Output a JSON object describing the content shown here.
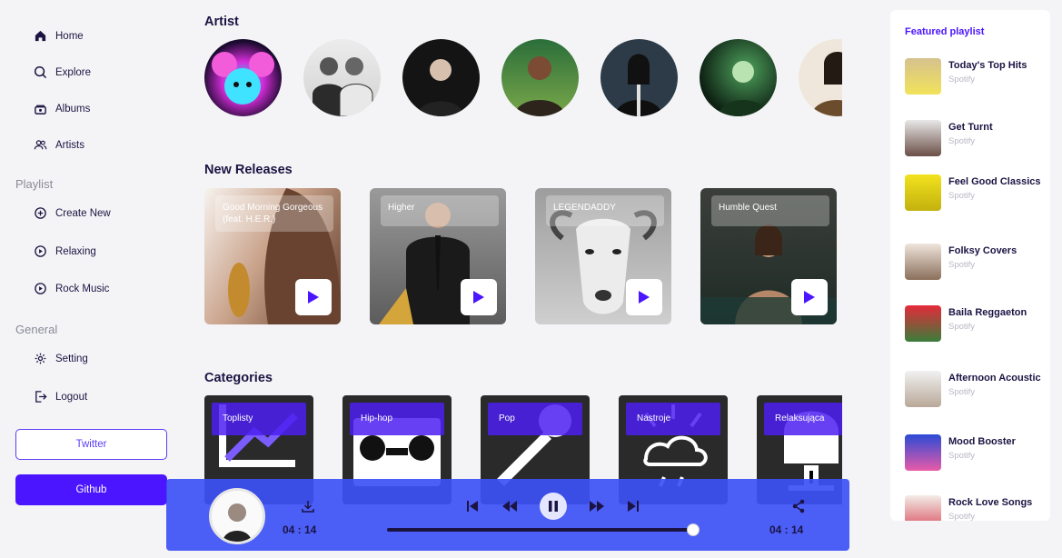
{
  "sidebar": {
    "menu": [
      {
        "label": "Home",
        "icon": "home-icon"
      },
      {
        "label": "Explore",
        "icon": "search-icon"
      },
      {
        "label": "Albums",
        "icon": "album-icon"
      },
      {
        "label": "Artists",
        "icon": "artists-icon"
      }
    ],
    "playlist_title": "Playlist",
    "playlist": [
      {
        "label": "Create New",
        "icon": "plus-circle-icon"
      },
      {
        "label": "Relaxing",
        "icon": "play-circle-icon"
      },
      {
        "label": "Rock Music",
        "icon": "play-circle-icon"
      }
    ],
    "general_title": "General",
    "general": [
      {
        "label": "Setting",
        "icon": "gear-icon"
      },
      {
        "label": "Logout",
        "icon": "logout-icon"
      }
    ],
    "twitter_label": "Twitter",
    "github_label": "Github"
  },
  "main": {
    "artist_heading": "Artist",
    "releases_heading": "New Releases",
    "categories_heading": "Categories",
    "releases": [
      {
        "title": "Good Morning Gorgeous (feat. H.E.R.)"
      },
      {
        "title": "Higher"
      },
      {
        "title": "LEGENDADDY"
      },
      {
        "title": "Humble Quest"
      }
    ],
    "categories": [
      {
        "label": "Toplisty"
      },
      {
        "label": "Hip-hop"
      },
      {
        "label": "Pop"
      },
      {
        "label": "Nastroje"
      },
      {
        "label": "Relaksująca"
      }
    ]
  },
  "featured": {
    "title": "Featured playlist",
    "items": [
      {
        "name": "Today's Top Hits",
        "source": "Spotify"
      },
      {
        "name": "Get Turnt",
        "source": "Spotify"
      },
      {
        "name": "Feel Good Classics",
        "source": "Spotify"
      },
      {
        "name": "Folksy Covers",
        "source": "Spotify"
      },
      {
        "name": "Baila Reggaeton",
        "source": "Spotify"
      },
      {
        "name": "Afternoon Acoustic",
        "source": "Spotify"
      },
      {
        "name": "Mood Booster",
        "source": "Spotify"
      },
      {
        "name": "Rock Love Songs",
        "source": "Spotify"
      }
    ]
  },
  "player": {
    "time_elapsed": "04 : 14",
    "time_total": "04 : 14",
    "progress_fraction": 1.0
  },
  "colors": {
    "accent": "#4b15ff",
    "player_bg": "#3c50f5",
    "text_dark": "#1b1443"
  }
}
